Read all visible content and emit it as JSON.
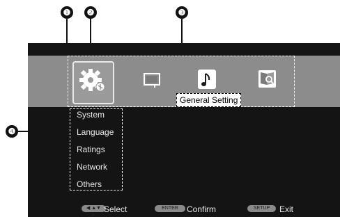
{
  "callouts": [
    "❶",
    "❷",
    "❸",
    "❹"
  ],
  "menu": {
    "icons": [
      "setup-gear-icon",
      "display-icon",
      "music-icon",
      "photo-search-icon"
    ],
    "selected_label": "General Setting",
    "items": [
      "System",
      "Language",
      "Ratings",
      "Network",
      "Others"
    ]
  },
  "footer": {
    "select_key": "◀ ▲▼ ▶",
    "select_label": "Select",
    "enter_key": "ENTER",
    "confirm_label": "Confirm",
    "setup_key": "SETUP",
    "exit_label": "Exit"
  }
}
